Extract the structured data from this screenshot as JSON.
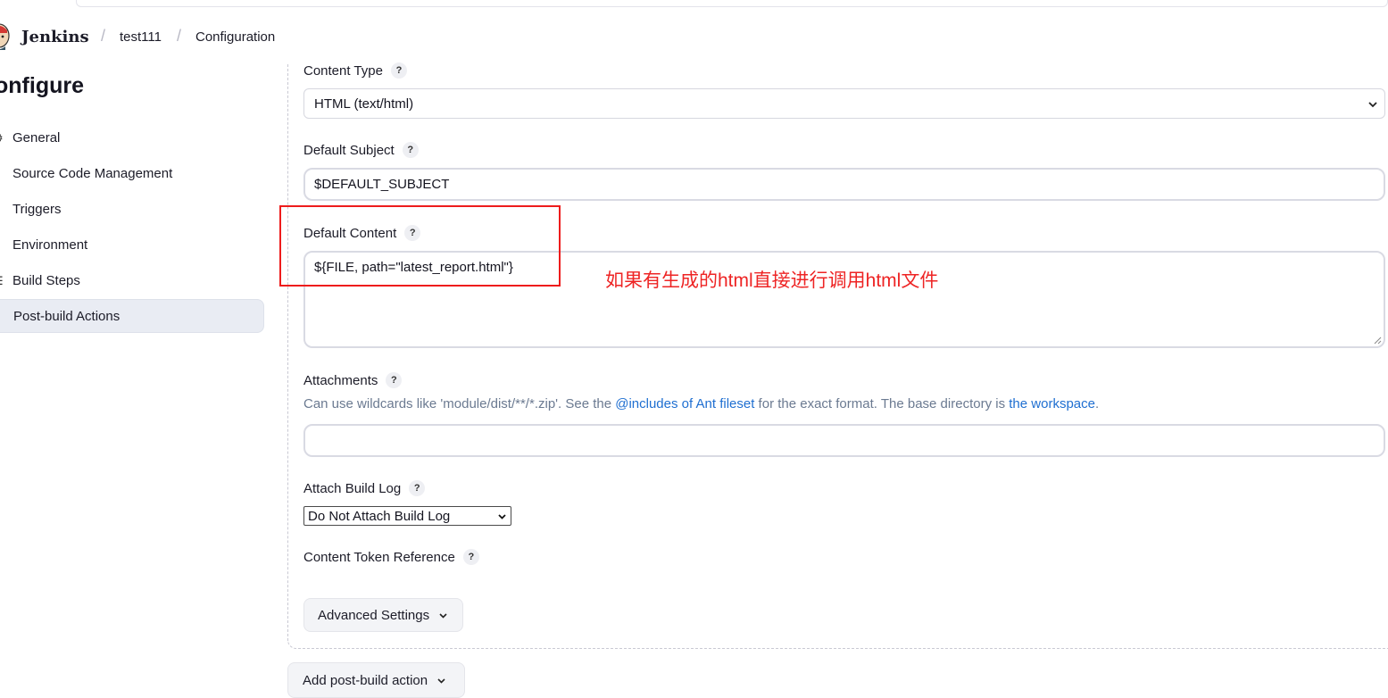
{
  "header": {
    "brand": "Jenkins",
    "breadcrumbs": [
      "test111",
      "Configuration"
    ]
  },
  "sidebar": {
    "title": "onfigure",
    "items": [
      {
        "label": "General",
        "icon": "gear-icon"
      },
      {
        "label": "Source Code Management",
        "icon": "branch-icon"
      },
      {
        "label": "Triggers",
        "icon": "clock-icon"
      },
      {
        "label": "Environment",
        "icon": "globe-icon"
      },
      {
        "label": "Build Steps",
        "icon": "list-icon"
      },
      {
        "label": "Post-build Actions",
        "icon": "cube-icon",
        "active": true
      }
    ]
  },
  "form": {
    "content_type": {
      "label": "Content Type",
      "value": "HTML (text/html)"
    },
    "default_subject": {
      "label": "Default Subject",
      "value": "$DEFAULT_SUBJECT"
    },
    "default_content": {
      "label": "Default Content",
      "value": "${FILE, path=\"latest_report.html\"}"
    },
    "attachments": {
      "label": "Attachments",
      "hint_prefix": "Can use wildcards like 'module/dist/**/*.zip'. See the ",
      "hint_link1": "@includes of Ant fileset",
      "hint_middle": " for the exact format. The base directory is ",
      "hint_link2": "the workspace",
      "hint_suffix": ".",
      "value": ""
    },
    "attach_build_log": {
      "label": "Attach Build Log",
      "value": "Do Not Attach Build Log"
    },
    "content_token_reference": {
      "label": "Content Token Reference"
    },
    "advanced_settings": "Advanced Settings",
    "add_post_build_action": "Add post-build action"
  },
  "help_symbol": "?",
  "annotation": "如果有生成的html直接进行调用html文件",
  "colors": {
    "annotation_red": "#ee1c1c",
    "link_blue": "#1f6fd1",
    "hint_gray": "#6b7a91"
  }
}
